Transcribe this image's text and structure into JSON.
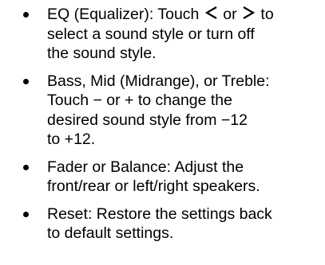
{
  "bullets": [
    {
      "lines": [
        {
          "before": "EQ (Equalizer): Touch ",
          "icon": "chevron-left-icon",
          "middle": " or ",
          "icon2": "chevron-right-icon",
          "after": " to"
        },
        "select a sound style or turn off",
        "the sound style."
      ]
    },
    {
      "lines": [
        "Bass, Mid (Midrange), or Treble:",
        "Touch − or + to change the",
        "desired sound style from −12",
        "to +12."
      ]
    },
    {
      "lines": [
        "Fader or Balance: Adjust the",
        "front/rear or left/right speakers."
      ]
    },
    {
      "lines": [
        "Reset: Restore the settings back",
        "to default settings."
      ]
    }
  ]
}
